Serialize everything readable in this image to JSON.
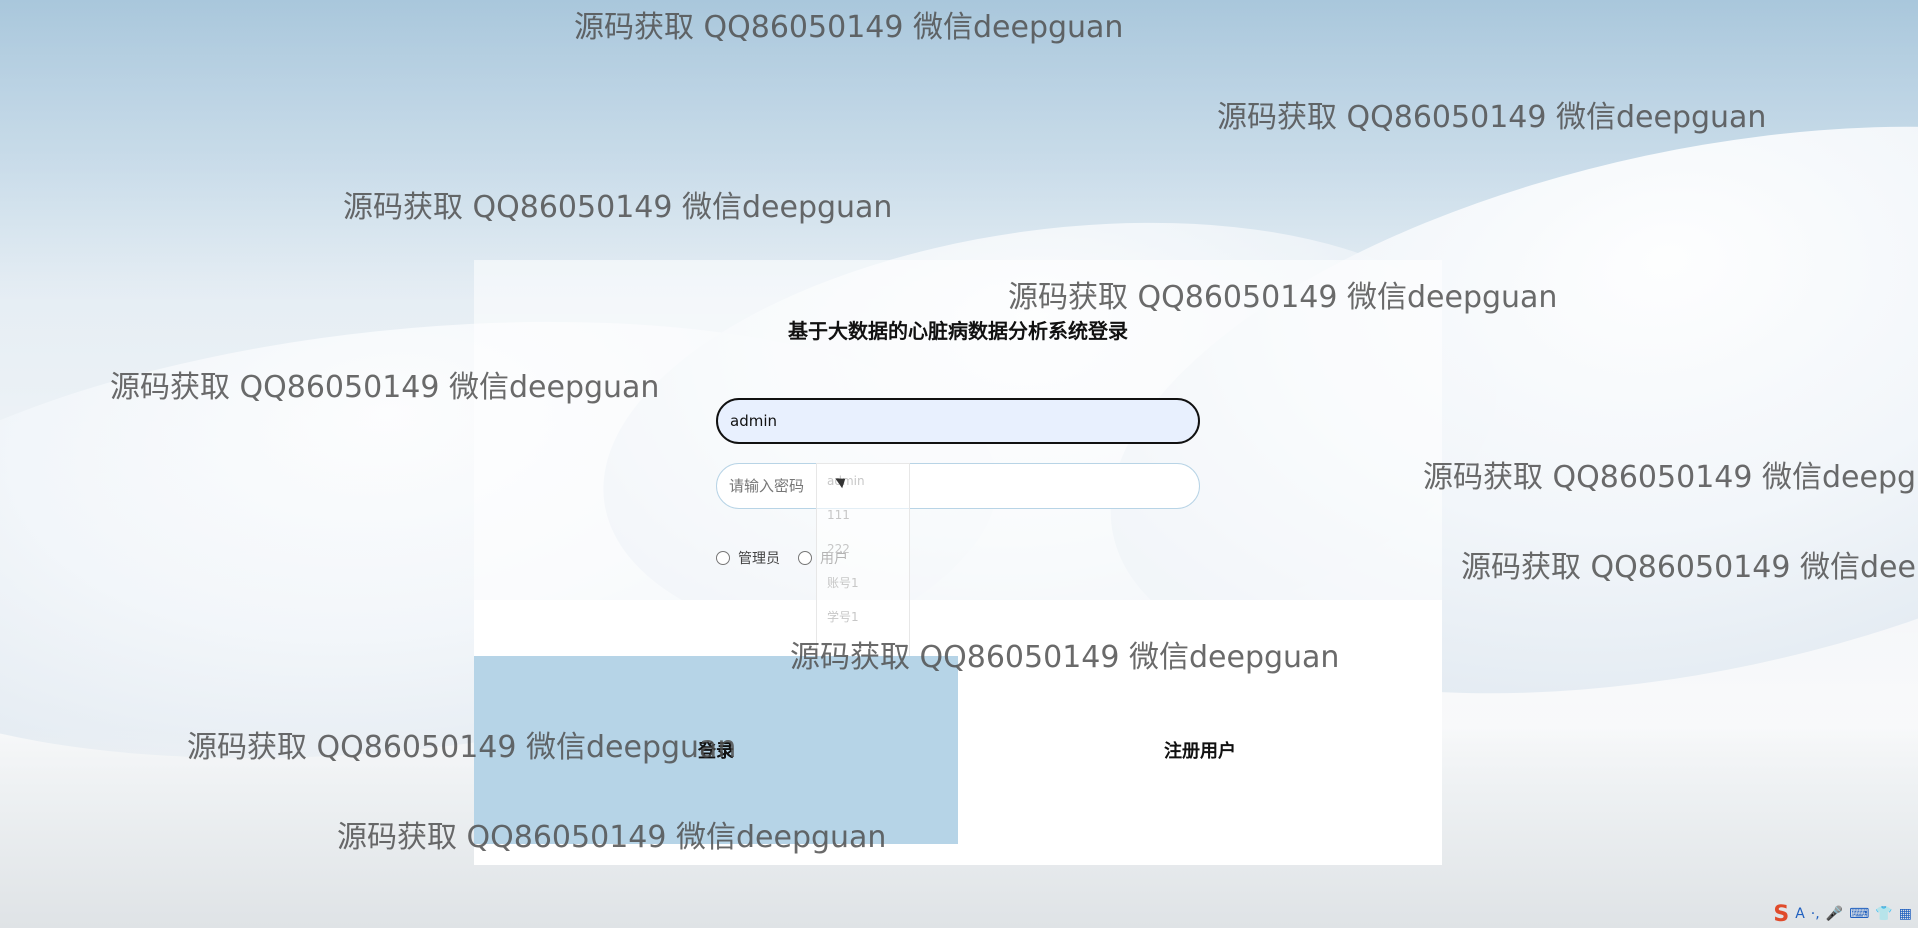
{
  "login": {
    "title": "基于大数据的心脏病数据分析系统登录",
    "username_value": "admin",
    "password_placeholder": "请输入密码",
    "roles": [
      "管理员",
      "用户"
    ],
    "login_button": "登录",
    "register_button": "注册用户"
  },
  "autocomplete": {
    "items": [
      "admin",
      "111",
      "222",
      "账号1",
      "学号1"
    ]
  },
  "watermark": {
    "text": "源码获取 QQ86050149 微信deepguan"
  },
  "ime_tray": {
    "items": [
      "S",
      "A",
      "·,",
      "🎤",
      "⌨",
      "👕",
      "▦"
    ]
  },
  "colors": {
    "login_button_bg": "#b6d4e7",
    "username_field_bg": "#e8f0fe"
  }
}
